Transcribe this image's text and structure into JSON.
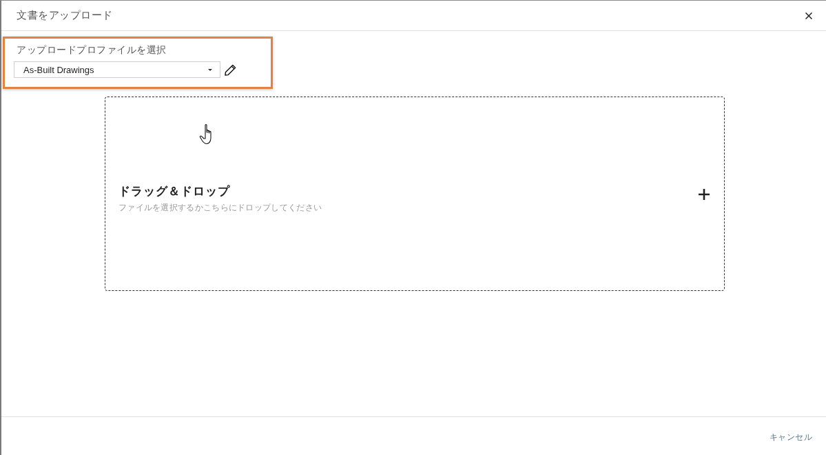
{
  "dialog": {
    "title": "文書をアップロード"
  },
  "profile_selector": {
    "label": "アップロードプロファイルを選択",
    "value": "As-Built Drawings",
    "highlighted": true
  },
  "drop_zone": {
    "title": "ドラッグ＆ドロップ",
    "hint": "ファイルを選択するかこちらにドロップしてください"
  },
  "footer": {
    "buttons": [
      {
        "label": "キャンセル"
      }
    ]
  }
}
